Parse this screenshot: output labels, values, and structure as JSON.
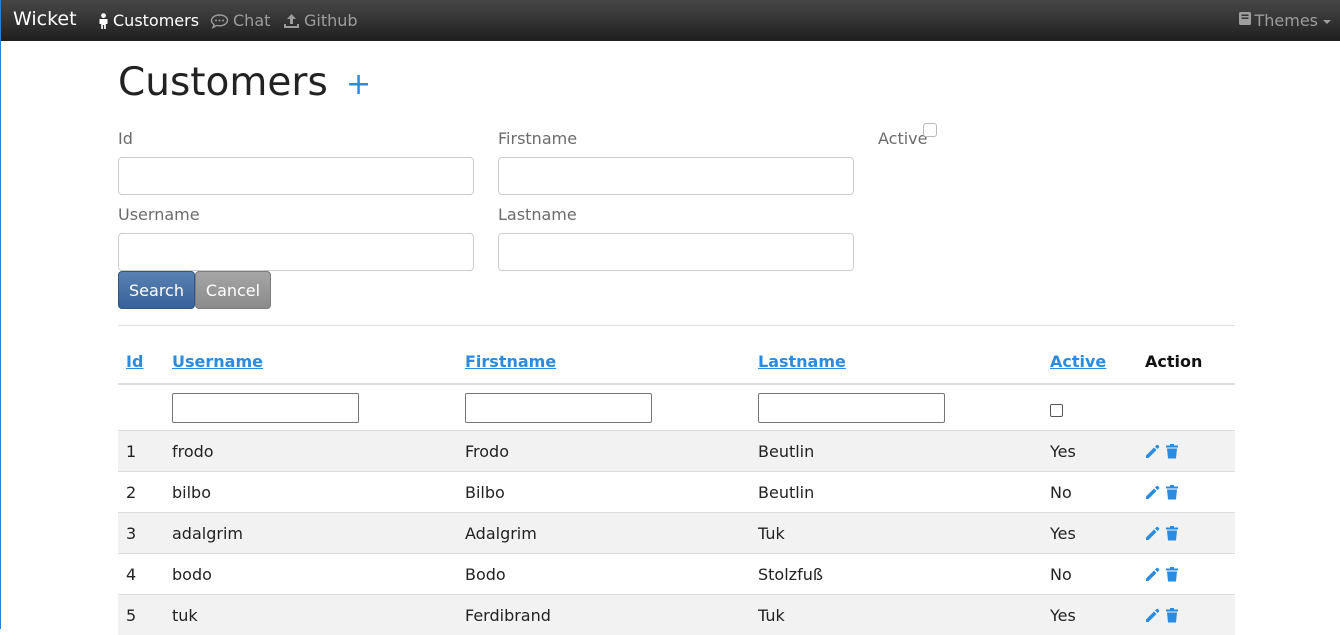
{
  "navbar": {
    "brand": "Wicket",
    "items": [
      {
        "label": "Customers",
        "icon": "person-icon",
        "active": true
      },
      {
        "label": "Chat",
        "icon": "comment-icon",
        "active": false
      },
      {
        "label": "Github",
        "icon": "upload-icon",
        "active": false
      }
    ],
    "themes_label": "Themes"
  },
  "page": {
    "title": "Customers",
    "add_symbol": "+"
  },
  "search_form": {
    "id_label": "Id",
    "firstname_label": "Firstname",
    "active_label": "Active",
    "username_label": "Username",
    "lastname_label": "Lastname",
    "search_button": "Search",
    "cancel_button": "Cancel"
  },
  "table": {
    "headers": [
      "Id",
      "Username",
      "Firstname",
      "Lastname",
      "Active",
      "Action"
    ],
    "rows": [
      {
        "id": "1",
        "username": "frodo",
        "firstname": "Frodo",
        "lastname": "Beutlin",
        "active": "Yes"
      },
      {
        "id": "2",
        "username": "bilbo",
        "firstname": "Bilbo",
        "lastname": "Beutlin",
        "active": "No"
      },
      {
        "id": "3",
        "username": "adalgrim",
        "firstname": "Adalgrim",
        "lastname": "Tuk",
        "active": "Yes"
      },
      {
        "id": "4",
        "username": "bodo",
        "firstname": "Bodo",
        "lastname": "Stolzfuß",
        "active": "No"
      },
      {
        "id": "5",
        "username": "tuk",
        "firstname": "Ferdibrand",
        "lastname": "Tuk",
        "active": "Yes"
      }
    ]
  },
  "colors": {
    "accent": "#2a8be0",
    "navbar_bg": "#2b2b2b",
    "search_button": "#4a72a8",
    "cancel_button": "#999999"
  }
}
